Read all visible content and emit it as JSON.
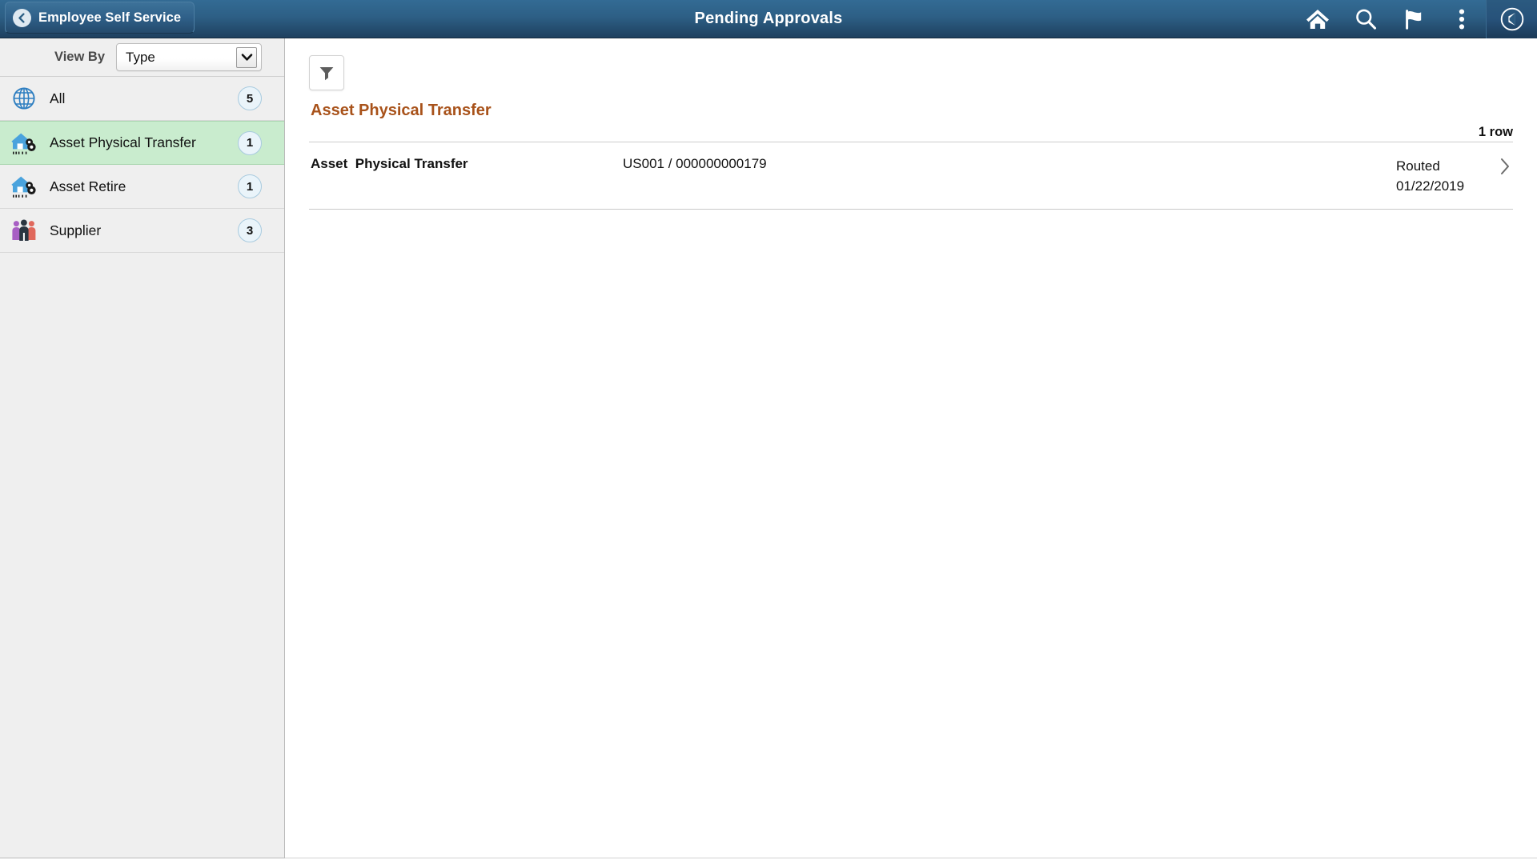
{
  "header": {
    "back_label": "Employee Self Service",
    "back_icon": "chevron-left-icon",
    "title": "Pending Approvals",
    "icons": [
      {
        "name": "home-icon",
        "label": "Home"
      },
      {
        "name": "search-icon",
        "label": "Search"
      },
      {
        "name": "flag-icon",
        "label": "Notifications"
      },
      {
        "name": "actions-menu-icon",
        "label": "Actions"
      },
      {
        "name": "navbar-compass-icon",
        "label": "NavBar"
      }
    ],
    "colors": {
      "gradient_top": "#336b94",
      "gradient_bottom": "#1e405f",
      "text": "#ffffff"
    }
  },
  "sidebar": {
    "view_by": {
      "label": "View By",
      "selected": "Type",
      "options": [
        "Type"
      ],
      "dropdown_icon": "chevron-down-icon"
    },
    "items": [
      {
        "label": "All",
        "count": "5",
        "icon": "globe-icon",
        "selected": false
      },
      {
        "label": "Asset Physical Transfer",
        "count": "1",
        "icon": "asset-gear-icon",
        "selected": true
      },
      {
        "label": "Asset Retire",
        "count": "1",
        "icon": "asset-gear-icon",
        "selected": false
      },
      {
        "label": "Supplier",
        "count": "3",
        "icon": "people-group-icon",
        "selected": false
      }
    ],
    "colors": {
      "background": "#efefef",
      "selected_background": "#c9ecce",
      "badge_border": "#a8cade",
      "badge_fill": "#eaf4fa"
    }
  },
  "main": {
    "filter_button": {
      "name": "filter-button",
      "icon": "funnel-icon"
    },
    "group": {
      "title": "Asset Physical Transfer",
      "title_color": "#a8521a",
      "row_count_label": "1 row"
    },
    "rows": [
      {
        "type": "Asset  Physical Transfer",
        "reference": "US001 / 000000000179",
        "status": "Routed",
        "date": "01/22/2019",
        "chevron": "chevron-right-icon"
      }
    ]
  }
}
